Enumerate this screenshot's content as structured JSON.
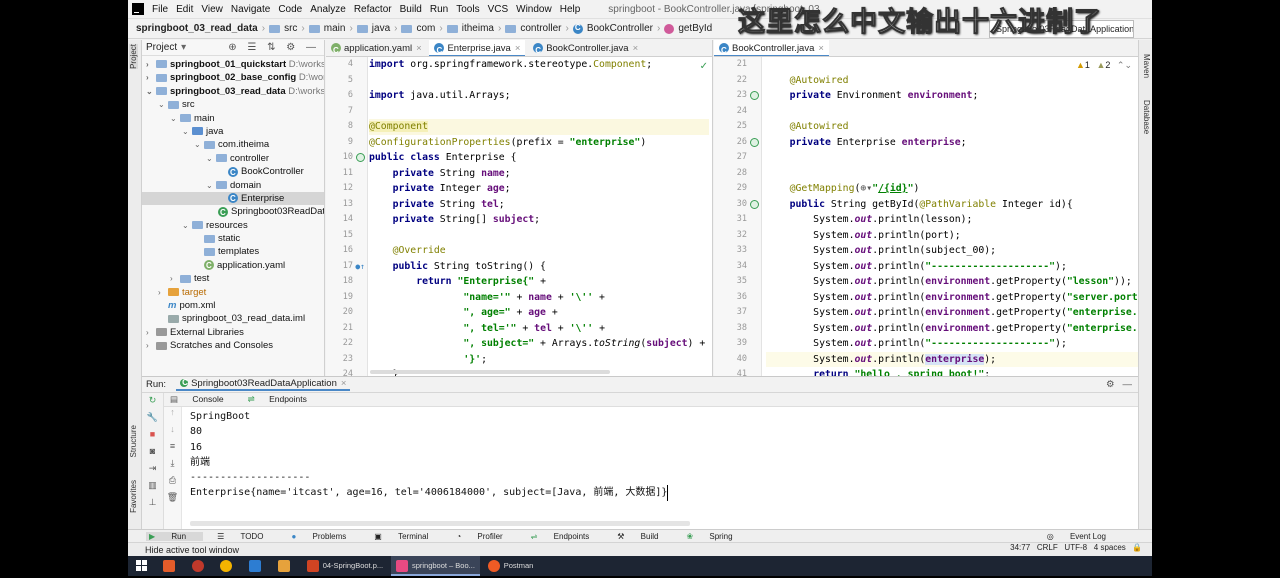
{
  "menubar": {
    "items": [
      "File",
      "Edit",
      "View",
      "Navigate",
      "Code",
      "Analyze",
      "Refactor",
      "Build",
      "Run",
      "Tools",
      "VCS",
      "Window",
      "Help"
    ],
    "window_title": "springboot - BookController.java [springboot_03",
    "overlay_text": "这里怎么中文输出十六进制了"
  },
  "navbar": {
    "crumbs": [
      "springboot_03_read_data",
      "src",
      "main",
      "java",
      "com",
      "itheima",
      "controller",
      "BookController",
      "getById"
    ],
    "run_config": "Springboot03ReadDataApplication"
  },
  "sidebar": {
    "left_tabs": [
      "Project",
      "Structure",
      "Favorites"
    ],
    "right_tabs": [
      "Maven",
      "Database"
    ]
  },
  "project": {
    "title": "Project",
    "tree": [
      {
        "label": "springboot_01_quickstart",
        "path": "D:\\works",
        "bold": true
      },
      {
        "label": "springboot_02_base_config",
        "path": "D:\\work",
        "bold": true
      },
      {
        "label": "springboot_03_read_data",
        "path": "D:\\worksp",
        "bold": true
      },
      {
        "label": "src"
      },
      {
        "label": "main"
      },
      {
        "label": "java"
      },
      {
        "label": "com.itheima"
      },
      {
        "label": "controller"
      },
      {
        "label": "BookController"
      },
      {
        "label": "domain"
      },
      {
        "label": "Enterprise"
      },
      {
        "label": "Springboot03ReadDataA"
      },
      {
        "label": "resources"
      },
      {
        "label": "static"
      },
      {
        "label": "templates"
      },
      {
        "label": "application.yaml"
      },
      {
        "label": "test"
      },
      {
        "label": "target"
      },
      {
        "label": "pom.xml"
      },
      {
        "label": "springboot_03_read_data.iml"
      },
      {
        "label": "External Libraries"
      },
      {
        "label": "Scratches and Consoles"
      }
    ]
  },
  "editor_left": {
    "tabs": [
      "application.yaml",
      "Enterprise.java",
      "BookController.java"
    ],
    "line_numbers": [
      "4",
      "5",
      "6",
      "7",
      "8",
      "9",
      "10",
      "11",
      "12",
      "13",
      "14",
      "15",
      "16",
      "17",
      "18",
      "19",
      "20",
      "21",
      "22",
      "23",
      "24"
    ],
    "lines": [
      "import org.springframework.stereotype.Component;",
      "",
      "import java.util.Arrays;",
      "",
      "@Component",
      "@ConfigurationProperties(prefix = \"enterprise\")",
      "public class Enterprise {",
      "    private String name;",
      "    private Integer age;",
      "    private String tel;",
      "    private String[] subject;",
      "",
      "    @Override",
      "    public String toString() {",
      "        return \"Enterprise{\" +",
      "                \"name='\" + name + '\\'' +",
      "                \", age=\" + age +",
      "                \", tel='\" + tel + '\\'' +",
      "                \", subject=\" + Arrays.toString(subject) +",
      "                '}';",
      "    }"
    ]
  },
  "editor_right": {
    "tabs": [
      "BookController.java"
    ],
    "warnings": "1",
    "weak_warnings": "2",
    "line_numbers": [
      "21",
      "22",
      "23",
      "24",
      "25",
      "26",
      "27",
      "28",
      "29",
      "30",
      "31",
      "32",
      "33",
      "34",
      "35",
      "36",
      "37",
      "38",
      "39",
      "40",
      "41"
    ],
    "lines": [
      "",
      "    @Autowired",
      "    private Environment environment;",
      "",
      "    @Autowired",
      "    private Enterprise enterprise;",
      "",
      "",
      "    @GetMapping(\"/{id}\")",
      "    public String getById(@PathVariable Integer id){",
      "        System.out.println(lesson);",
      "        System.out.println(port);",
      "        System.out.println(subject_00);",
      "        System.out.println(\"--------------------\");",
      "        System.out.println(environment.getProperty(\"lesson\"));",
      "        System.out.println(environment.getProperty(\"server.port\"",
      "        System.out.println(environment.getProperty(\"enterprise.a",
      "        System.out.println(environment.getProperty(\"enterprise.s",
      "        System.out.println(\"--------------------\");",
      "        System.out.println(enterprise);",
      "        return \"hello , spring boot!\";"
    ]
  },
  "run": {
    "label": "Run:",
    "config": "Springboot03ReadDataApplication",
    "tabs": [
      "Console",
      "Endpoints"
    ],
    "output": [
      "SpringBoot",
      "80",
      "16",
      "前端",
      "--------------------",
      "Enterprise{name='itcast', age=16, tel='4006184000', subject=[Java, 前端, 大数据]}"
    ]
  },
  "toolwindows": [
    "Run",
    "TODO",
    "Problems",
    "Terminal",
    "Profiler",
    "Endpoints",
    "Build",
    "Spring"
  ],
  "event_log": "Event Log",
  "status": {
    "message": "Hide active tool window",
    "position": "34:77",
    "line_sep": "CRLF",
    "encoding": "UTF-8",
    "indent": "4 spaces"
  },
  "taskbar": {
    "items": [
      "04-SpringBoot.p...",
      "springboot – Boo...",
      "Postman"
    ]
  }
}
